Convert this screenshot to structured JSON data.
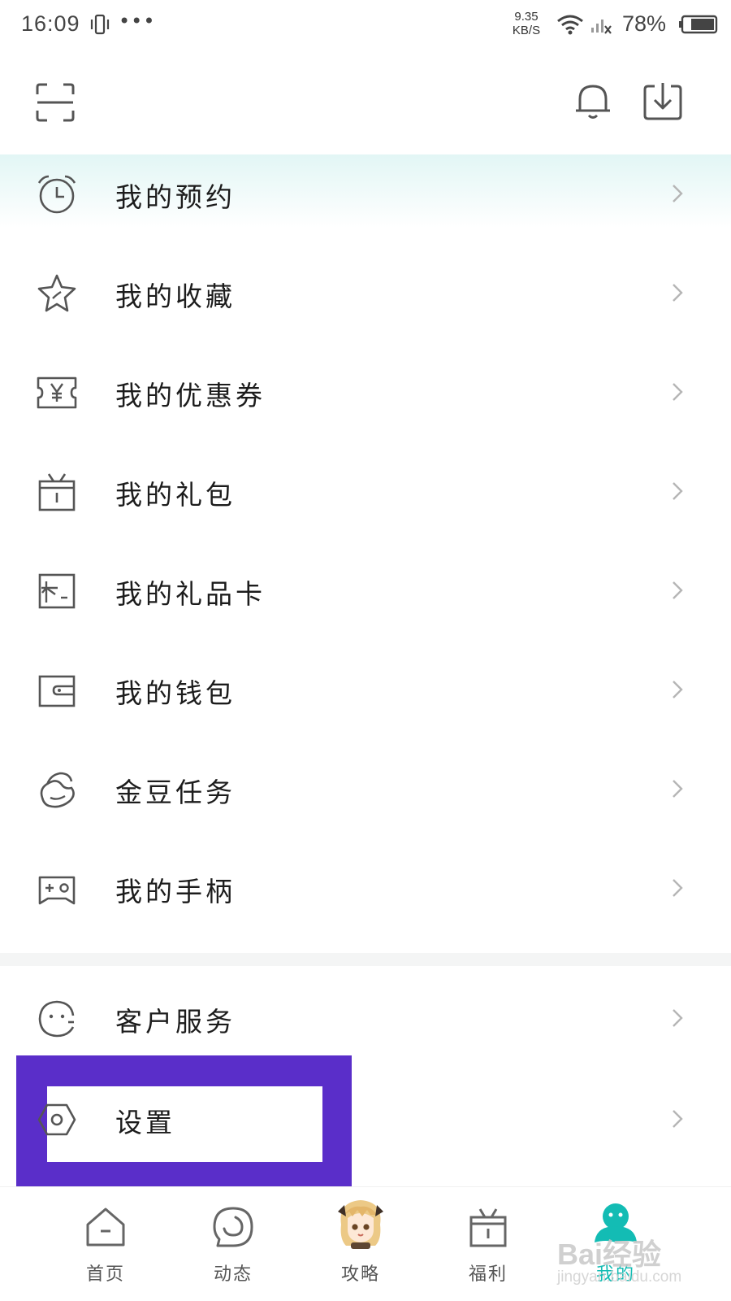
{
  "status_bar": {
    "time": "16:09",
    "dots": "•••",
    "net_speed_value": "9.35",
    "net_speed_unit": "KB/S",
    "battery_percent": "78%"
  },
  "header": {
    "left_icon": "scan-icon",
    "right_icons": [
      "bell-icon",
      "download-icon"
    ]
  },
  "menu": {
    "group1": [
      {
        "label": "我的预约",
        "icon": "alarm-clock-icon"
      },
      {
        "label": "我的收藏",
        "icon": "star-icon"
      },
      {
        "label": "我的优惠券",
        "icon": "coupon-icon"
      },
      {
        "label": "我的礼包",
        "icon": "gift-box-icon"
      },
      {
        "label": "我的礼品卡",
        "icon": "gift-card-icon"
      },
      {
        "label": "我的钱包",
        "icon": "wallet-icon"
      },
      {
        "label": "金豆任务",
        "icon": "bean-icon"
      },
      {
        "label": "我的手柄",
        "icon": "gamepad-icon"
      }
    ],
    "group2": [
      {
        "label": "客户服务",
        "icon": "customer-service-icon"
      },
      {
        "label": "设置",
        "icon": "settings-icon"
      }
    ]
  },
  "tab_bar": {
    "tabs": [
      {
        "label": "首页",
        "icon": "home-icon"
      },
      {
        "label": "动态",
        "icon": "activity-icon"
      },
      {
        "label": "攻略",
        "icon": "guide-avatar-icon"
      },
      {
        "label": "福利",
        "icon": "welfare-gift-icon"
      },
      {
        "label": "我的",
        "icon": "mine-icon",
        "active": true
      }
    ]
  },
  "watermark": {
    "brand": "Bai经验",
    "url": "jingyan.baidu.com"
  },
  "colors": {
    "accent": "#13bcb4",
    "highlight": "#5a2ec9",
    "icon_stroke": "#555555",
    "chevron": "#b5b5b5"
  }
}
